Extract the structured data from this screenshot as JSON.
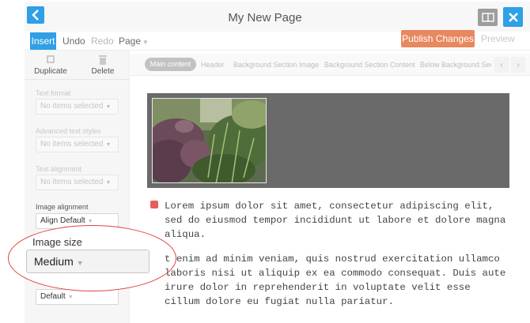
{
  "header": {
    "title": "My New Page",
    "back_icon": "chevron-left-icon",
    "layout_icon": "layout-toggle-icon",
    "close_icon": "close-icon",
    "accent_color": "#2f9fe6"
  },
  "toolbar": {
    "insert_label": "Insert",
    "undo_label": "Undo",
    "redo_label": "Redo",
    "page_label": "Page",
    "publish_label": "Publish Changes",
    "preview_label": "Preview",
    "publish_color": "#e8885e"
  },
  "left_panel": {
    "duplicate_label": "Duplicate",
    "delete_label": "Delete",
    "text_format": {
      "label": "Text format",
      "value": "No items selected"
    },
    "advanced_text_styles": {
      "label": "Advanced text styles",
      "value": "No items selected"
    },
    "text_alignment": {
      "label": "Text alignment",
      "value": "No items selected"
    },
    "image_alignment": {
      "label": "Image alignment",
      "value": "Align Default"
    },
    "image_size": {
      "label": "Image size",
      "value": "Medium"
    },
    "advanced": {
      "value": "Default"
    }
  },
  "tabs": {
    "active": "Main content",
    "items": [
      "Header",
      "Background Section Image",
      "Background Section Content",
      "Below Background Secti"
    ]
  },
  "content": {
    "paragraph1": "Lorem ipsum dolor sit amet, consectetur adipiscing elit,\nsed do eiusmod tempor incididunt ut labore et dolore magna\naliqua.",
    "paragraph2": "t enim ad minim veniam, quis nostrud exercitation ullamco\nlaboris nisi ut aliquip ex ea commodo consequat. Duis aute\nirure dolor in reprehenderit in voluptate velit esse\ncillum dolore eu fugiat nulla pariatur."
  }
}
